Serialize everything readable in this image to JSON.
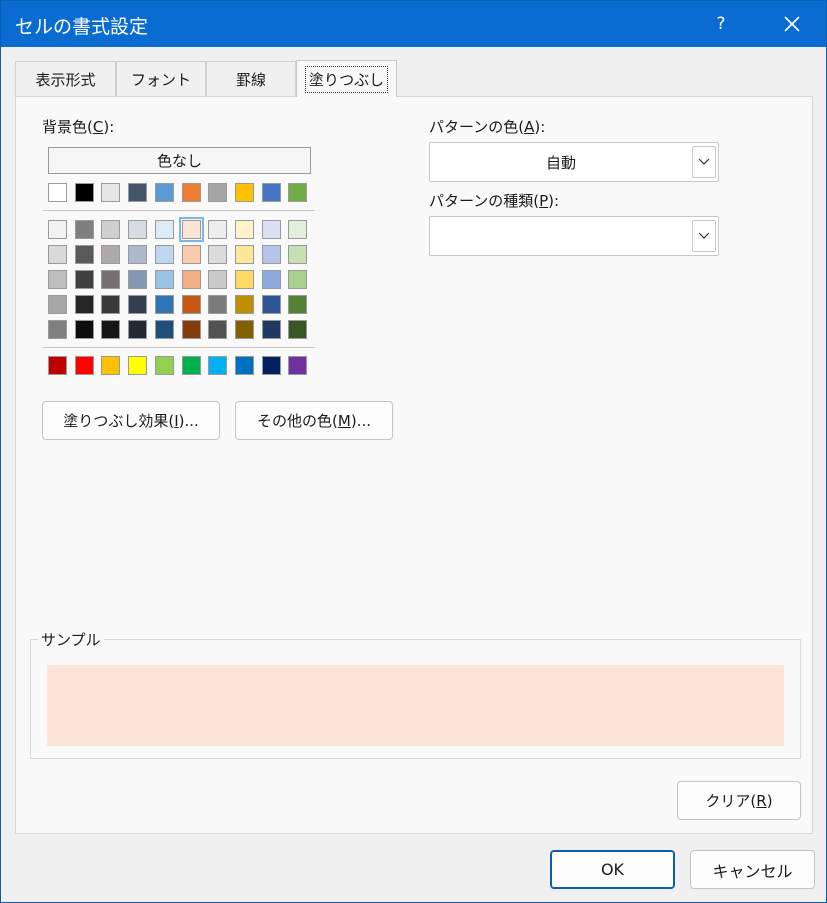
{
  "window": {
    "title": "セルの書式設定",
    "help_label": "?"
  },
  "tabs": [
    {
      "label": "表示形式"
    },
    {
      "label": "フォント"
    },
    {
      "label": "罫線"
    },
    {
      "label": "塗りつぶし",
      "active": true
    }
  ],
  "fill": {
    "background_label_pre": "背景色(",
    "background_label_key": "C",
    "background_label_post": "):",
    "no_color_label": "色なし",
    "selected_color": "#fce4d6",
    "theme_top_row": [
      "#ffffff",
      "#000000",
      "#e7e6e6",
      "#44546a",
      "#5b9bd5",
      "#ed7d31",
      "#a5a5a5",
      "#ffc000",
      "#4472c4",
      "#70ad47"
    ],
    "theme_shades": [
      [
        "#f2f2f2",
        "#7f7f7f",
        "#d0cece",
        "#d6dce4",
        "#ddebf7",
        "#fce4d6",
        "#ededed",
        "#fff2cc",
        "#d9e1f2",
        "#e2efda"
      ],
      [
        "#d9d9d9",
        "#595959",
        "#aeaaaa",
        "#acb9ca",
        "#bdd7ee",
        "#f8cbad",
        "#dbdbdb",
        "#ffe699",
        "#b4c6e7",
        "#c6e0b4"
      ],
      [
        "#bfbfbf",
        "#404040",
        "#767171",
        "#8497b0",
        "#9bc2e6",
        "#f4b084",
        "#c9c9c9",
        "#ffd966",
        "#8ea9db",
        "#a9d08e"
      ],
      [
        "#a6a6a6",
        "#262626",
        "#3a3838",
        "#333f4f",
        "#2f75b5",
        "#c65911",
        "#7b7b7b",
        "#bf8f00",
        "#2f5597",
        "#548235"
      ],
      [
        "#808080",
        "#0d0d0d",
        "#161616",
        "#222b35",
        "#1f4e78",
        "#833c0c",
        "#525252",
        "#806000",
        "#203864",
        "#375623"
      ]
    ],
    "standard_colors": [
      "#c00000",
      "#ff0000",
      "#ffc000",
      "#ffff00",
      "#92d050",
      "#00b050",
      "#00b0f0",
      "#0070c0",
      "#002060",
      "#7030a0"
    ],
    "fill_effects_pre": "塗りつぶし効果(",
    "fill_effects_key": "I",
    "fill_effects_post": ")...",
    "more_colors_pre": "その他の色(",
    "more_colors_key": "M",
    "more_colors_post": ")..."
  },
  "pattern": {
    "color_label_pre": "パターンの色(",
    "color_label_key": "A",
    "color_label_post": "):",
    "color_value": "自動",
    "style_label_pre": "パターンの種類(",
    "style_label_key": "P",
    "style_label_post": "):",
    "style_value": ""
  },
  "sample": {
    "label": "サンプル",
    "color": "#fce4d6"
  },
  "clear": {
    "pre": "クリア(",
    "key": "R",
    "post": ")"
  },
  "footer": {
    "ok_label": "OK",
    "cancel_label": "キャンセル"
  }
}
